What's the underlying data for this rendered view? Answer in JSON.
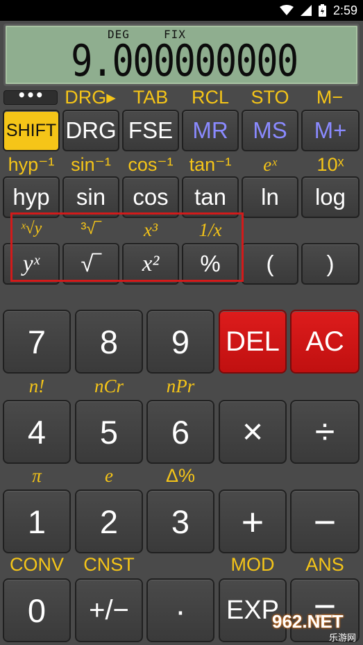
{
  "status": {
    "time": "2:59"
  },
  "display": {
    "deg": "DEG",
    "fix": "FIX",
    "value": "9.000000000"
  },
  "row1": {
    "menu": "•••",
    "labels": [
      "DRG▸",
      "TAB",
      "RCL",
      "STO",
      "M−"
    ]
  },
  "row2": [
    "SHIFT",
    "DRG",
    "FSE",
    "MR",
    "MS",
    "M+"
  ],
  "row3_labels": [
    "hyp⁻¹",
    "sin⁻¹",
    "cos⁻¹",
    "tan⁻¹",
    "eˣ",
    "10ˣ"
  ],
  "row3": [
    "hyp",
    "sin",
    "cos",
    "tan",
    "ln",
    "log"
  ],
  "row4_labels": [
    "ˣ√y",
    "³√‾",
    "x³",
    "1/x"
  ],
  "row4": [
    "yˣ",
    "√‾",
    "x²",
    "%",
    "(",
    ")"
  ],
  "numrow1": [
    "7",
    "8",
    "9",
    "DEL",
    "AC"
  ],
  "numrow2_labels": [
    "n!",
    "nCr",
    "nPr"
  ],
  "numrow2": [
    "4",
    "5",
    "6",
    "×",
    "÷"
  ],
  "numrow3_labels": [
    "π",
    "e",
    "Δ%"
  ],
  "numrow3": [
    "1",
    "2",
    "3",
    "+",
    "−"
  ],
  "numrow4_labels": [
    "CONV",
    "CNST",
    "MOD",
    "ANS"
  ],
  "numrow4": [
    "0",
    "+/−",
    "·",
    "EXP",
    "="
  ],
  "watermark": {
    "brand": "962.NET",
    "sub": "乐游网"
  },
  "colors": {
    "accent": "#f5c518",
    "memory": "#8a8aff",
    "danger": "#dd1c1c",
    "lcd": "#8fae8f"
  }
}
